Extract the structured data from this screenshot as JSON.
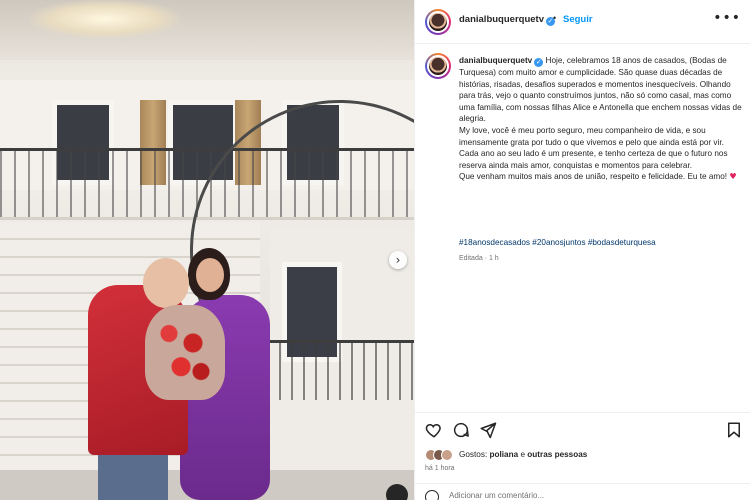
{
  "post": {
    "username": "danialbuquerquetv",
    "follow_label": "Seguir",
    "dot": "•",
    "more": "•••",
    "caption_lines": [
      "Hoje, celebramos 18 anos de casados, (Bodas de Turquesa) com muito amor e cumplicidade. São quase duas décadas de histórias, risadas, desafios superados e momentos inesquecíveis. Olhando para trás, vejo o quanto construímos juntos, não só como casal, mas como uma família, com nossas filhas Alice e Antonella que enchem nossas vidas de alegria.",
      "My love, você é meu porto seguro, meu companheiro de vida, e sou imensamente grata por tudo o que vivemos e pelo que ainda está por vir. Cada ano ao seu lado é um presente, e tenho certeza de que o futuro nos reserva ainda mais amor, conquistas e momentos para celebrar.",
      "Que venham muitos mais anos de união, respeito e felicidade. Eu te amo!"
    ],
    "heart": "♥",
    "hashtags": "#18anosdecasados #20anosjuntos #bodasdeturquesa",
    "edited": "Editada · 1 h",
    "likes": {
      "prefix": "Gostos: ",
      "user": "poliana",
      "connector": " e ",
      "others": "outras pessoas"
    },
    "time": "há 1 hora",
    "comment_placeholder": "Adicionar um comentário..."
  },
  "photo": {
    "next_arrow": "›"
  },
  "colors": {
    "accent": "#0095f6",
    "verified": "#3897f0",
    "heart": "#e0245e",
    "hashtag": "#00376b"
  },
  "icons": [
    "heart-icon",
    "comment-icon",
    "share-icon",
    "bookmark-icon",
    "verified-icon",
    "emoji-icon"
  ]
}
